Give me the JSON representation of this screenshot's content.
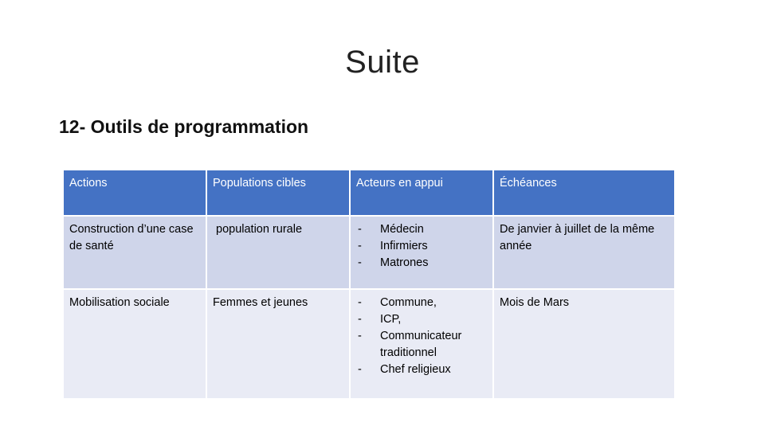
{
  "slide": {
    "title": "Suite",
    "subtitle": "12- Outils de programmation"
  },
  "table": {
    "headers": [
      "Actions",
      "Populations cibles",
      "Acteurs en appui",
      "Échéances"
    ],
    "rows": [
      {
        "action": "Construction d’une case de santé",
        "population": "population rurale",
        "acteurs": [
          "Médecin",
          "Infirmiers",
          "Matrones"
        ],
        "echeance": "De janvier à juillet de la même année"
      },
      {
        "action": "Mobilisation sociale",
        "population": "Femmes et jeunes",
        "acteurs": [
          "Commune,",
          "ICP,",
          "Communicateur traditionnel",
          "Chef religieux"
        ],
        "echeance": "Mois de Mars"
      }
    ]
  },
  "colors": {
    "header_bg": "#4472c4",
    "row_odd_bg": "#cfd5ea",
    "row_even_bg": "#e9ebf5"
  }
}
